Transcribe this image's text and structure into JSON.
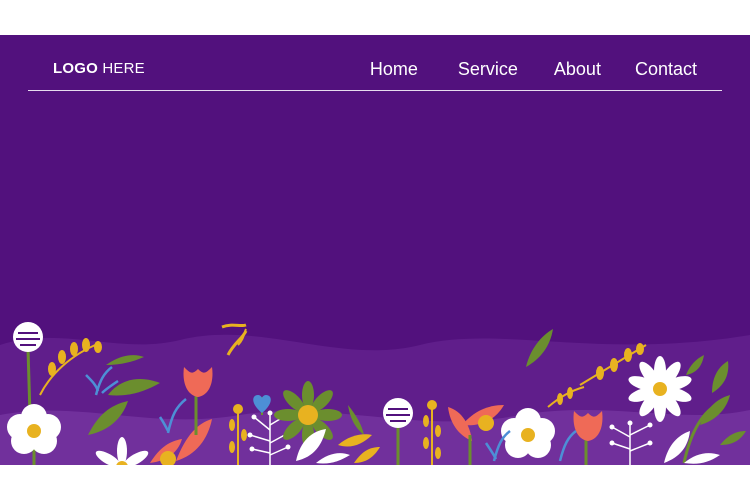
{
  "logo": {
    "bold": "LOGO",
    "regular": "HERE"
  },
  "nav": [
    "Home",
    "Service",
    "About",
    "Contact"
  ],
  "colors": {
    "background": "#52117d",
    "text": "#ffffff",
    "leaf_green": "#6b8e2e",
    "accent_yellow": "#e8b220",
    "accent_red": "#ef6a57",
    "accent_blue": "#4d8fd6",
    "flower_white": "#ffffff"
  },
  "illustration": "flower-meadow"
}
